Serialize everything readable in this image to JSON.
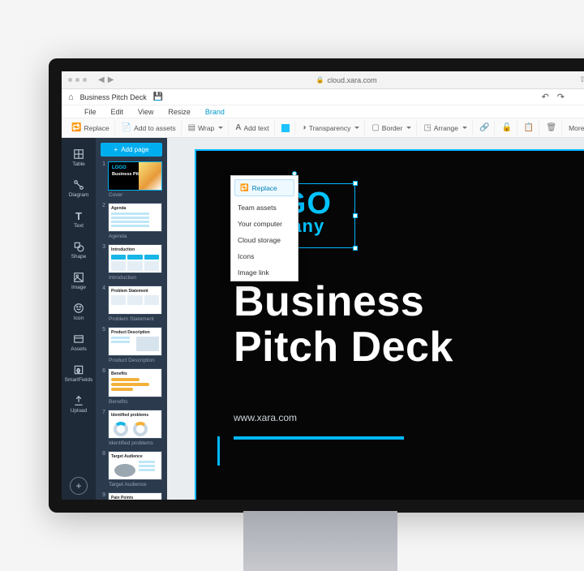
{
  "browser": {
    "url": "cloud.xara.com"
  },
  "doc": {
    "title": "Business Pitch Deck"
  },
  "menu": {
    "file": "File",
    "edit": "Edit",
    "view": "View",
    "resize": "Resize",
    "brand": "Brand"
  },
  "toolbar": {
    "replace": "Replace",
    "add_assets": "Add to assets",
    "wrap": "Wrap",
    "add_text": "Add text",
    "transparency": "Transparency",
    "border": "Border",
    "arrange": "Arrange",
    "more": "More"
  },
  "rail": {
    "items": [
      {
        "label": "Table"
      },
      {
        "label": "Diagram"
      },
      {
        "label": "Text"
      },
      {
        "label": "Shape"
      },
      {
        "label": "Image"
      },
      {
        "label": "Icon"
      },
      {
        "label": "Assets"
      },
      {
        "label": "SmartFields"
      },
      {
        "label": "Upload"
      }
    ]
  },
  "thumbs": {
    "add_page": "Add page",
    "pages": [
      {
        "label": "Cover",
        "title": "Business Pitch Deck",
        "logo": "LOGO"
      },
      {
        "label": "Agenda",
        "title": "Agenda"
      },
      {
        "label": "Introduction",
        "title": "Introduction"
      },
      {
        "label": "Problem Statement",
        "title": "Problem Statement"
      },
      {
        "label": "Product Description",
        "title": "Product Description"
      },
      {
        "label": "Benefits",
        "title": "Benefits"
      },
      {
        "label": "Identified problems",
        "title": "Identified problems"
      },
      {
        "label": "Target Audience",
        "title": "Target Audience"
      },
      {
        "label": "Pain Points",
        "title": "Pain Points"
      }
    ]
  },
  "replace_menu": {
    "button": "Replace",
    "options": [
      "Team assets",
      "Your computer",
      "Cloud storage",
      "Icons",
      "Image link"
    ]
  },
  "slide": {
    "logo_line1": "LOGO",
    "logo_line2": "Company",
    "title_line1": "Business",
    "title_line2": "Pitch Deck",
    "url": "www.xara.com"
  },
  "colors": {
    "accent": "#00b8ff",
    "dark_panel": "#2b3a4c",
    "rail": "#1f2a38"
  }
}
